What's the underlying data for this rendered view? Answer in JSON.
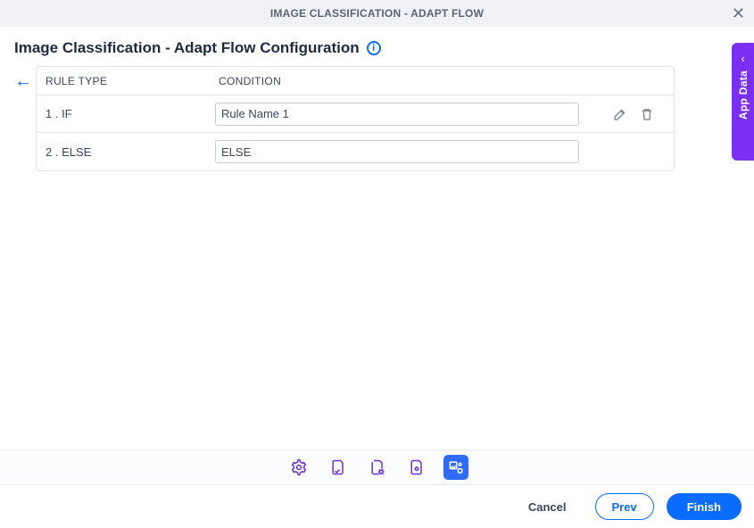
{
  "modal": {
    "title": "IMAGE CLASSIFICATION - ADAPT FLOW"
  },
  "page": {
    "title": "Image Classification - Adapt Flow Configuration"
  },
  "table": {
    "headers": {
      "ruleType": "RULE TYPE",
      "condition": "CONDITION"
    },
    "rows": [
      {
        "label": "1 . IF",
        "value": "Rule Name 1",
        "editable": true
      },
      {
        "label": "2 . ELSE",
        "value": "ELSE",
        "editable": false
      }
    ]
  },
  "sidebar": {
    "label": "App Data"
  },
  "footer": {
    "cancel": "Cancel",
    "prev": "Prev",
    "finish": "Finish"
  }
}
